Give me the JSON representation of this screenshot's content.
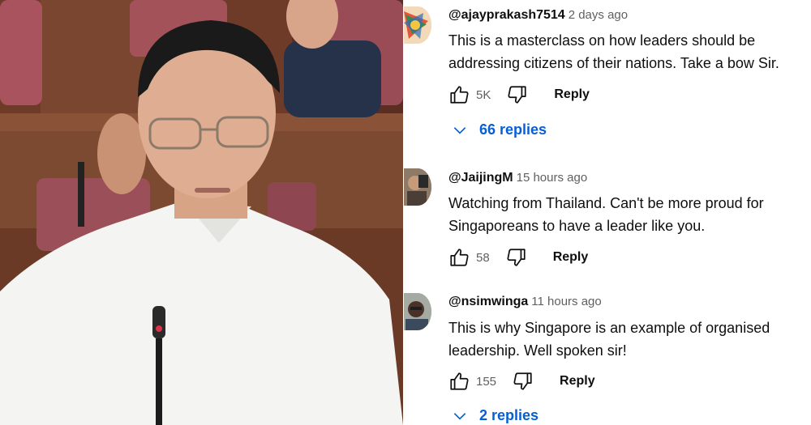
{
  "comments": [
    {
      "handle": "@ajayprakash7514",
      "time": "2 days ago",
      "text": "This is a masterclass on how leaders should be addressing citizens of their nations. Take a bow Sir.",
      "likes": "5K",
      "reply_label": "Reply",
      "replies_label": "66 replies"
    },
    {
      "handle": "@JaijingM",
      "time": "15 hours ago",
      "text": "Watching from Thailand. Can't be more proud for Singaporeans to have a leader like you.",
      "likes": "58",
      "reply_label": "Reply"
    },
    {
      "handle": "@nsimwinga",
      "time": "11 hours ago",
      "text": "This is why Singapore is an example of  organised leadership. Well spoken sir!",
      "likes": "155",
      "reply_label": "Reply",
      "replies_label": "2 replies"
    }
  ],
  "icons": {
    "like": "thumb-up-icon",
    "dislike": "thumb-down-icon",
    "expand": "chevron-down-icon"
  },
  "colors": {
    "replies_link": "#065fd4",
    "text": "#0f0f0f",
    "secondary": "#606060"
  }
}
